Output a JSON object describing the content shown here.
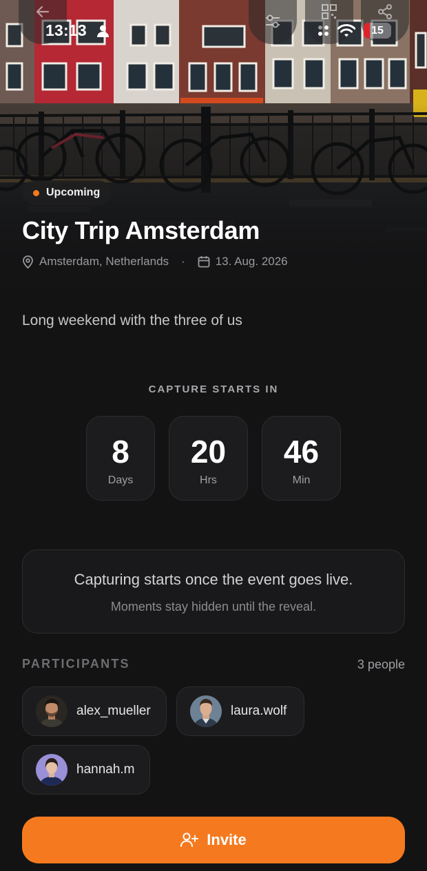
{
  "status_bar": {
    "time": "13:13",
    "battery": "15"
  },
  "hero": {
    "badge": "Upcoming",
    "title": "City Trip Amsterdam",
    "location": "Amsterdam, Netherlands",
    "separator": "·",
    "date": "13. Aug. 2026"
  },
  "description": "Long weekend with the three of us",
  "countdown": {
    "label": "CAPTURE STARTS IN",
    "days": {
      "value": "8",
      "unit": "Days"
    },
    "hours": {
      "value": "20",
      "unit": "Hrs"
    },
    "minutes": {
      "value": "46",
      "unit": "Min"
    }
  },
  "info": {
    "line1": "Capturing starts once the event goes live.",
    "line2": "Moments stay hidden until the reveal."
  },
  "participants": {
    "label": "PARTICIPANTS",
    "count": "3 people",
    "items": [
      {
        "name": "alex_mueller"
      },
      {
        "name": "laura.wolf"
      },
      {
        "name": "hannah.m"
      }
    ]
  },
  "invite_label": "Invite",
  "colors": {
    "accent": "#f57a1f",
    "background": "#131314",
    "card": "#1c1c1e"
  },
  "icons": [
    "back-arrow-icon",
    "person-icon",
    "sliders-icon",
    "qr-code-icon",
    "share-icon",
    "cellular-icon",
    "wifi-icon",
    "location-pin-icon",
    "calendar-icon",
    "add-user-icon"
  ]
}
